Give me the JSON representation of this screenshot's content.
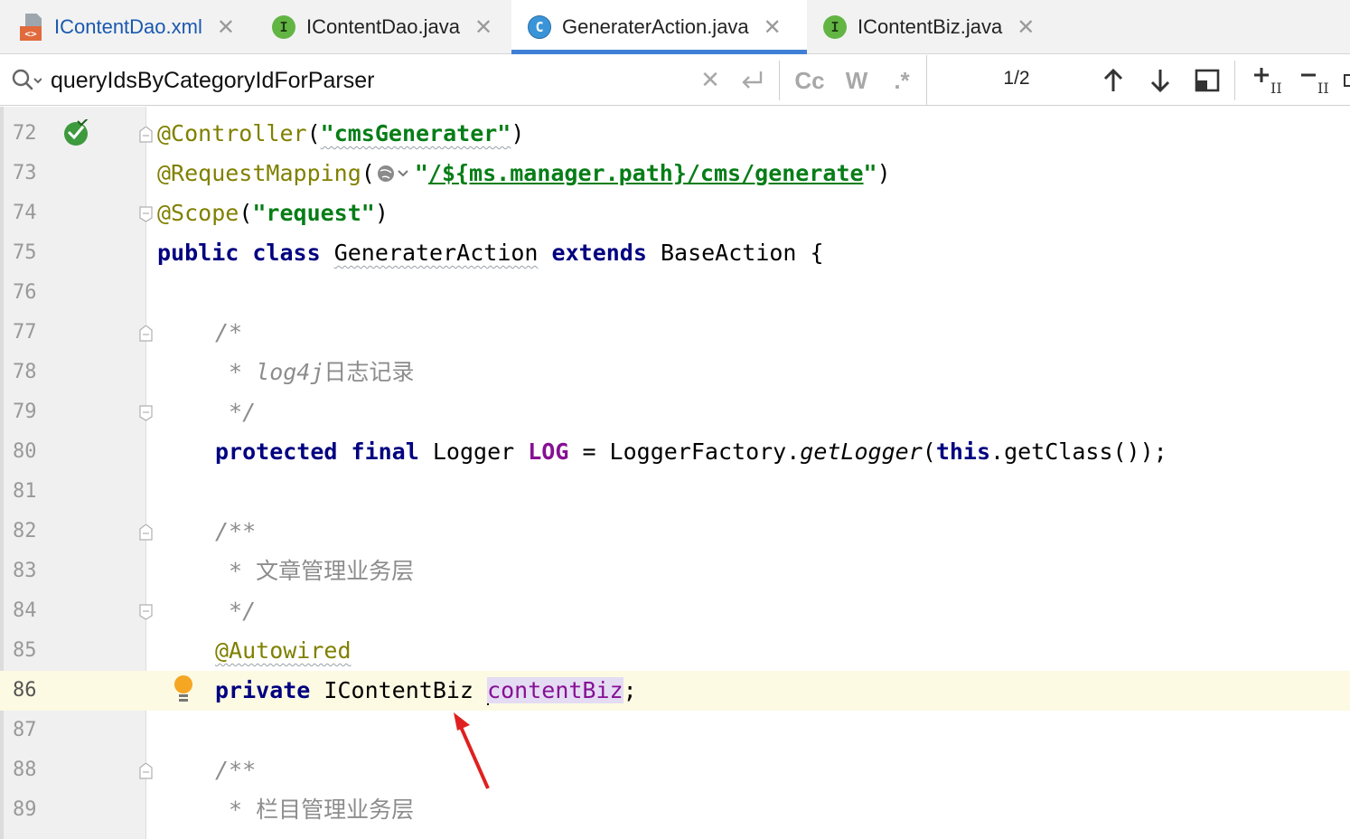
{
  "tabs": [
    {
      "label": "IContentDao.xml",
      "icon": "xml-file-icon",
      "active": false
    },
    {
      "label": "IContentDao.java",
      "icon": "interface-icon",
      "icon_letter": "I",
      "active": false
    },
    {
      "label": "GeneraterAction.java",
      "icon": "class-icon",
      "icon_letter": "C",
      "active": true
    },
    {
      "label": "IContentBiz.java",
      "icon": "interface-icon",
      "icon_letter": "I",
      "active": false
    }
  ],
  "search": {
    "value": "queryIdsByCategoryIdForParser",
    "match_count": "1/2",
    "case_label": "Cc",
    "words_label": "W",
    "regex_label": ".*"
  },
  "editor": {
    "current_line": "86",
    "lines": [
      {
        "num": "72"
      },
      {
        "num": "73"
      },
      {
        "num": "74"
      },
      {
        "num": "75"
      },
      {
        "num": "76"
      },
      {
        "num": "77"
      },
      {
        "num": "78"
      },
      {
        "num": "79"
      },
      {
        "num": "80"
      },
      {
        "num": "81"
      },
      {
        "num": "82"
      },
      {
        "num": "83"
      },
      {
        "num": "84"
      },
      {
        "num": "85"
      },
      {
        "num": "86"
      },
      {
        "num": "87"
      },
      {
        "num": "88"
      },
      {
        "num": "89"
      }
    ],
    "code": {
      "l72_ann": "@Controller",
      "l72_open": "(",
      "l72_str": "\"cmsGenerater\"",
      "l72_close": ")",
      "l73_ann": "@RequestMapping",
      "l73_open": "(",
      "l73_q1": "\"",
      "l73_path": "/${ms.manager.path}/cms/generate",
      "l73_q2": "\"",
      "l73_close": ")",
      "l74_ann": "@Scope",
      "l74_open": "(",
      "l74_str": "\"request\"",
      "l74_close": ")",
      "l75_kw1": "public",
      "l75_kw2": "class",
      "l75_name": "GeneraterAction",
      "l75_kw3": "extends",
      "l75_rest": "BaseAction {",
      "l77": "/*",
      "l78_star": " * ",
      "l78_text": "log4j",
      "l78_zh": "日志记录",
      "l79": " */",
      "l80_kw1": "protected",
      "l80_kw2": "final",
      "l80_type": "Logger",
      "l80_const": "LOG",
      "l80_eq": "= LoggerFactory.",
      "l80_method": "getLogger",
      "l80_p1": "(",
      "l80_this": "this",
      "l80_rest": ".getClass());",
      "l82": "/**",
      "l83_star": " * ",
      "l83_zh": "文章管理业务层",
      "l84": " */",
      "l85_ann": "@Autowired",
      "l86_kw": "private",
      "l86_type": "IContentBiz",
      "l86_field": "contentBiz",
      "l86_semi": ";",
      "l88": "/**",
      "l89_star": " * ",
      "l89_zh": "栏目管理业务层"
    }
  },
  "colors": {
    "keyword": "#000080",
    "annotation": "#808000",
    "string": "#067d17",
    "comment": "#8c8c8c",
    "field": "#871094",
    "current_line_bg": "#fcfae3",
    "arrow": "#e02020"
  }
}
